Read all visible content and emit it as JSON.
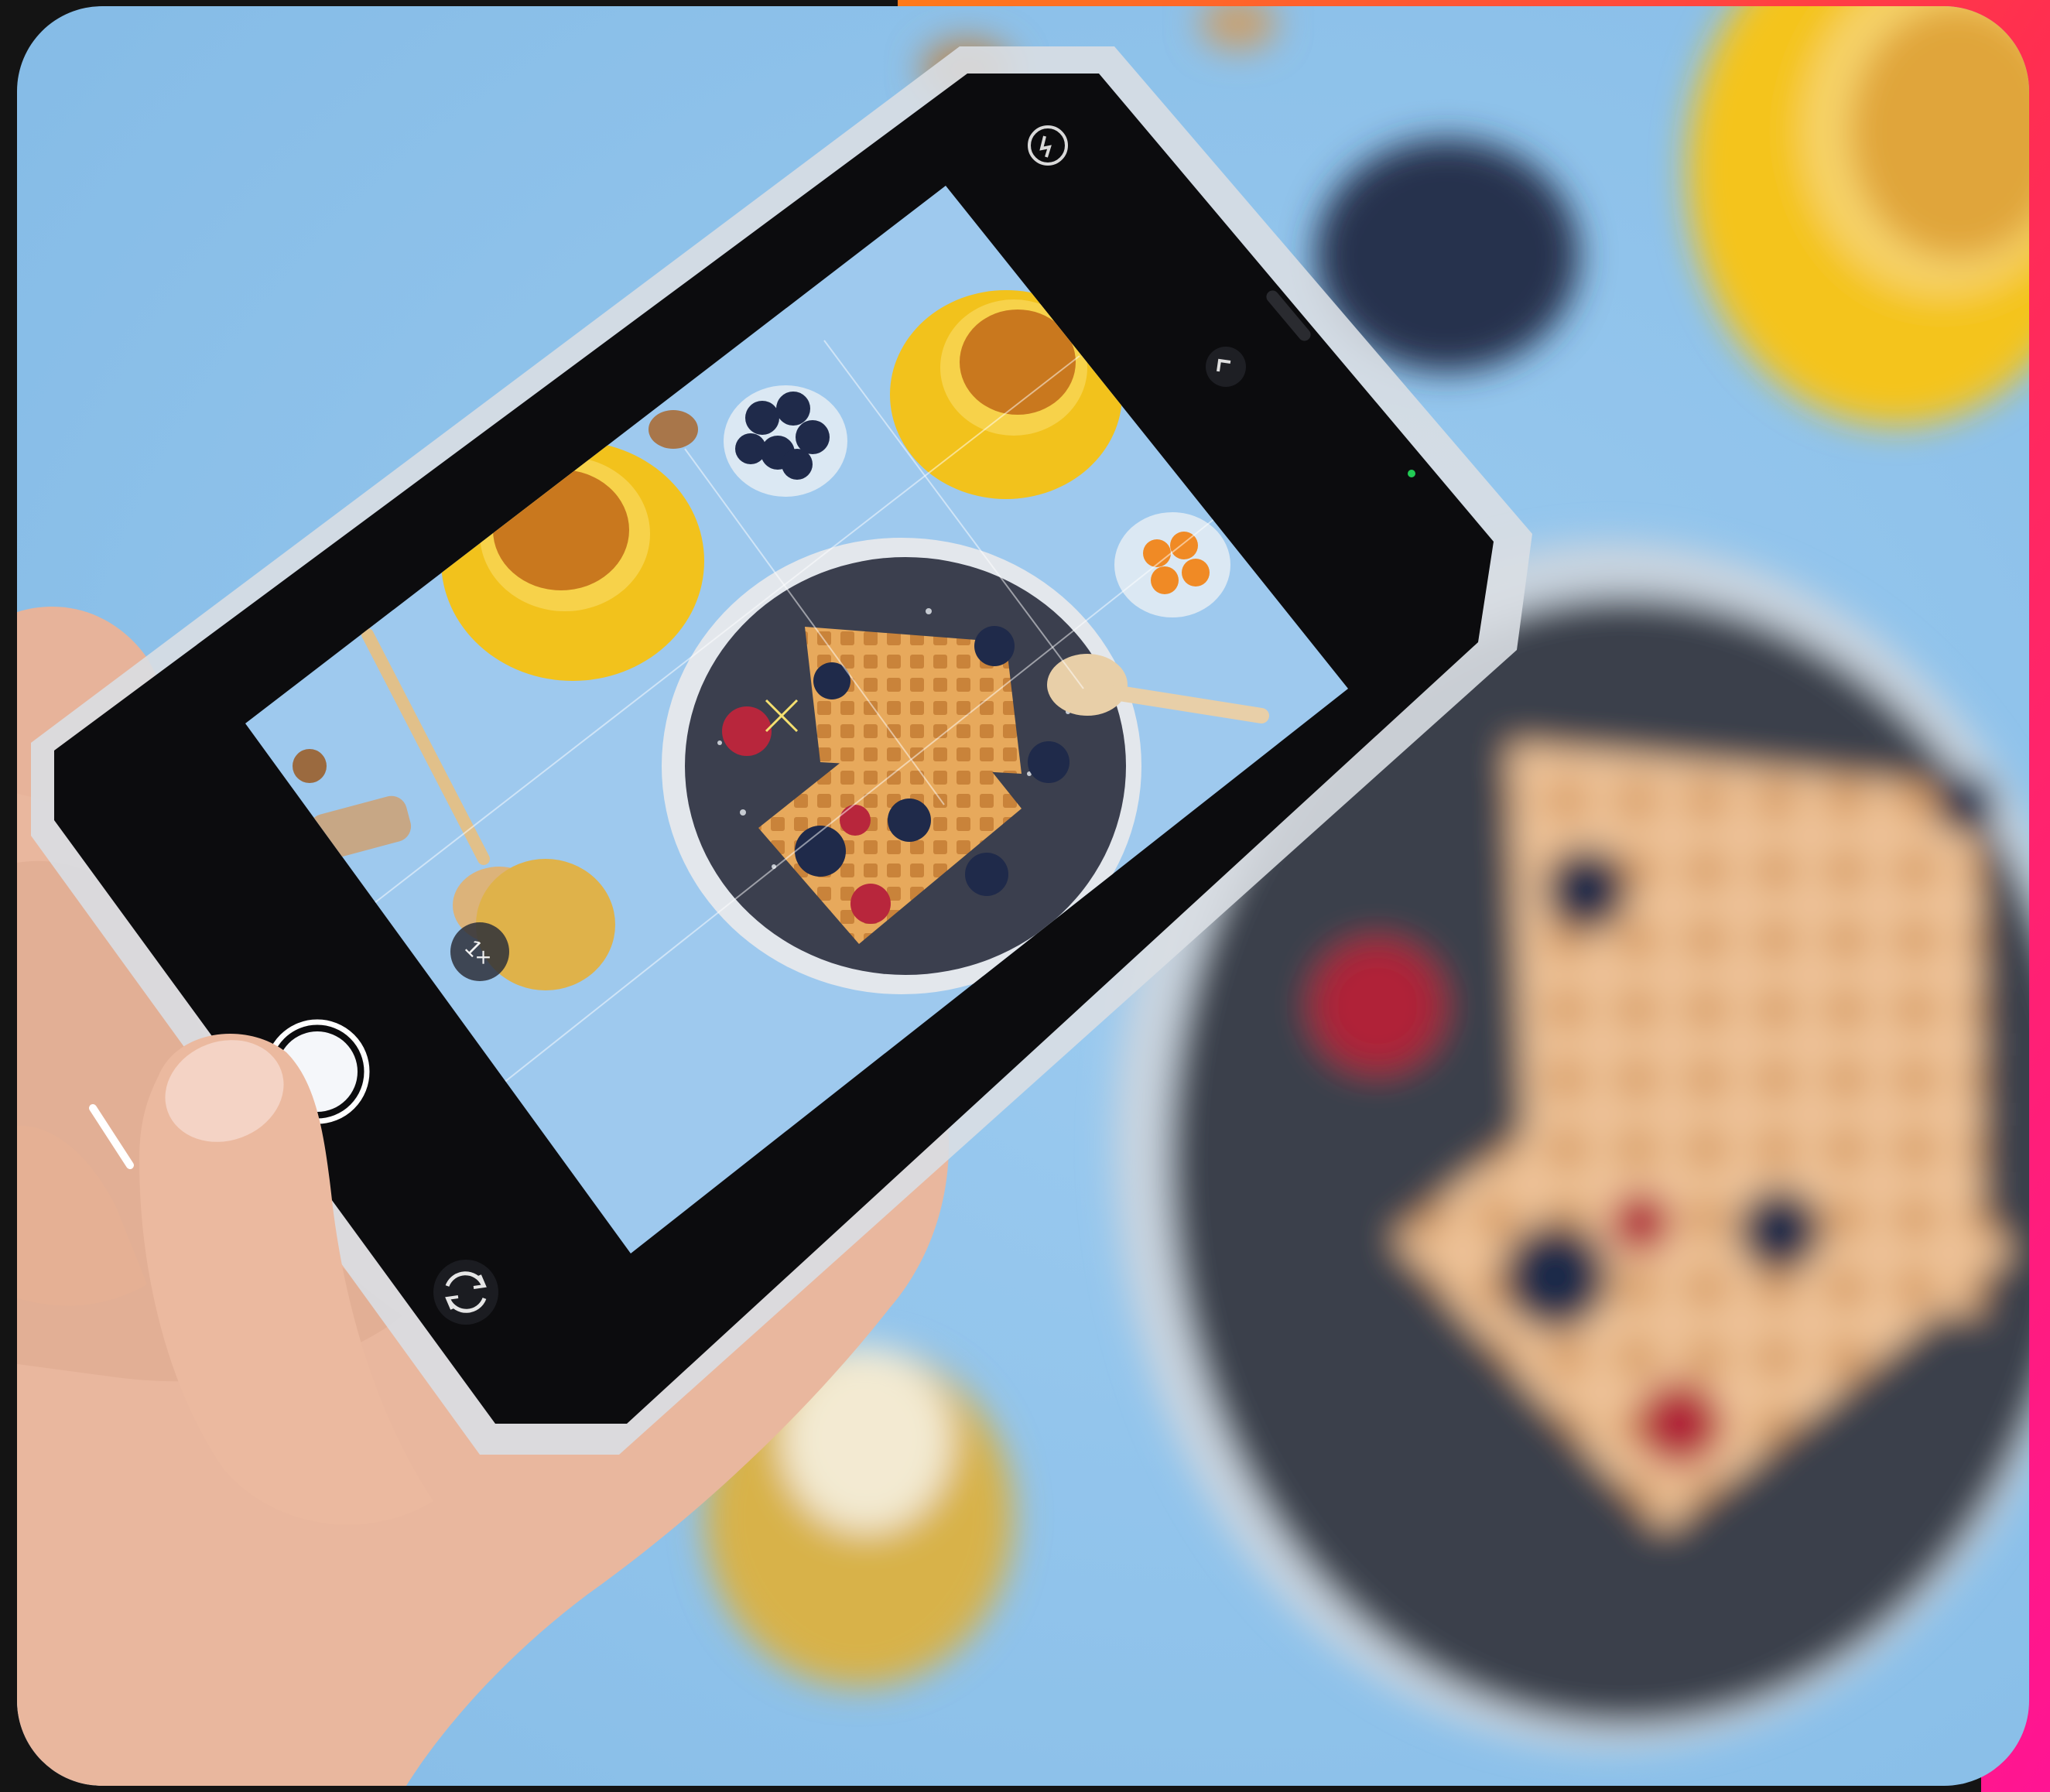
{
  "photo": {
    "zoom_label": "1×"
  },
  "colors": {
    "table_blue": "#8fc3ea",
    "saucer_yellow": "#f2c21c",
    "tea": "#c9781e",
    "plate": "#3b3f4e",
    "waffle": "#e3a45a",
    "blueberry": "#1f2a4a",
    "raspberry": "#b8263c",
    "accent_orange": "#ff5a1f",
    "accent_pink": "#ff1f7a"
  },
  "icons": [
    "flash-icon",
    "chevron-icon",
    "switch-camera-icon",
    "shutter-button"
  ]
}
